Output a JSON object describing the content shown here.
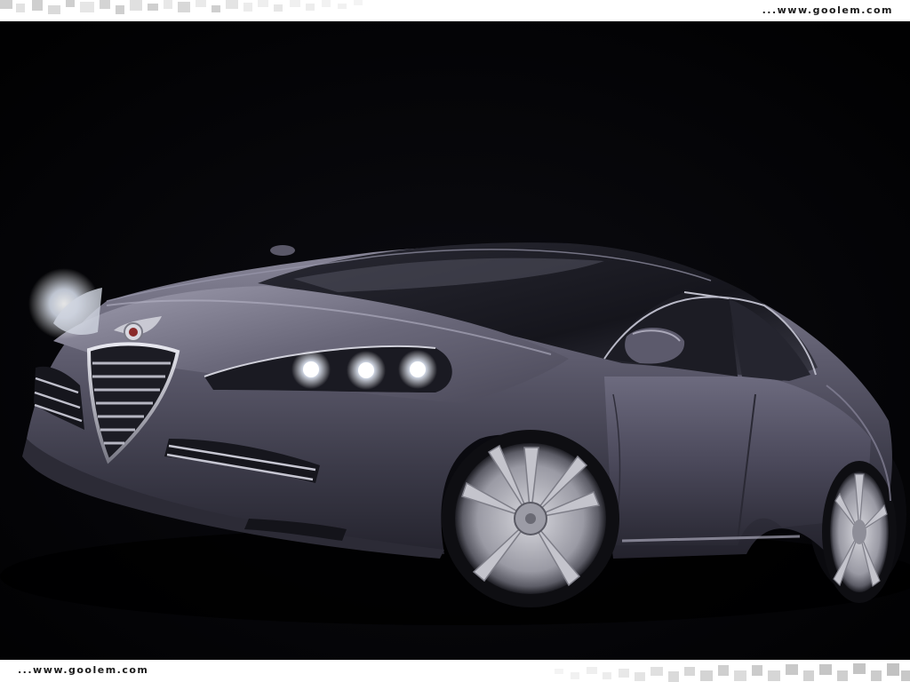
{
  "watermark": {
    "top": "...www.goolem.com",
    "bottom": "...www.goolem.com"
  },
  "colors": {
    "background": "#020204",
    "car_body": "#4a4858",
    "car_highlight": "#8e8ca0",
    "glass": "#1a1a22",
    "headlight": "#ffffff",
    "chrome": "#c8c8d0",
    "strip": "#ffffff"
  },
  "icons": {
    "emblem": "alfa-romeo-emblem-icon"
  }
}
